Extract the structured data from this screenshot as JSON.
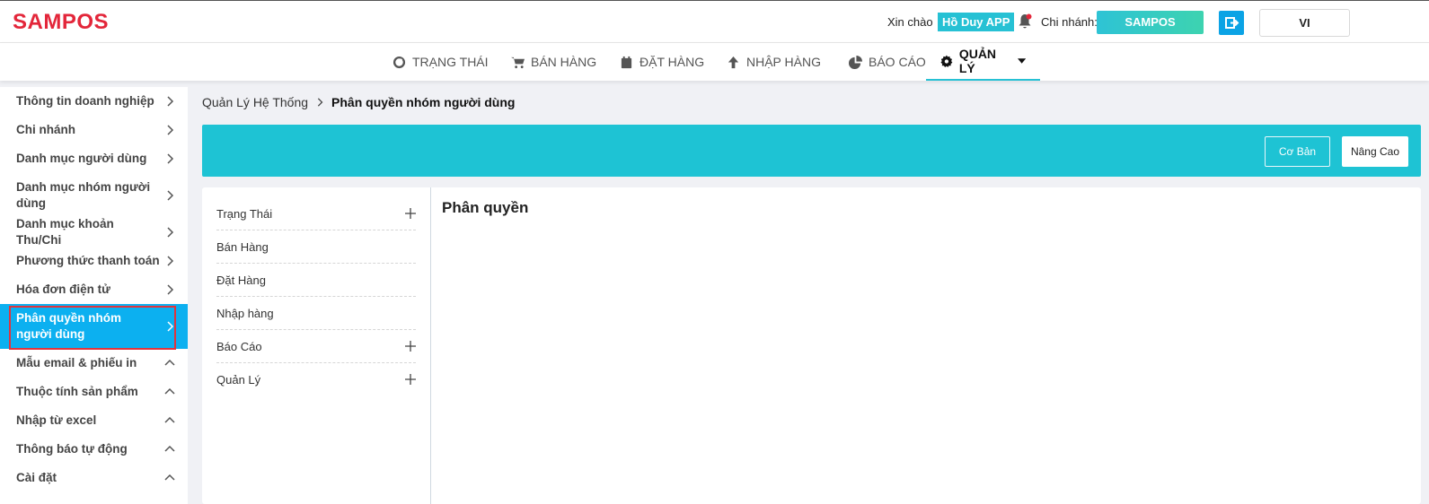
{
  "header": {
    "logo": "SAMPOS",
    "greeting": "Xin chào",
    "user_name": "Hồ Duy APP",
    "branch_label": "Chi nhánh:",
    "branch_name": "SAMPOS",
    "language": "VI",
    "logout_icon": "logout-icon",
    "bell_icon": "bell-icon"
  },
  "nav": {
    "items": [
      {
        "label": "TRẠNG THÁI",
        "icon": "dashboard-icon"
      },
      {
        "label": "BÁN HÀNG",
        "icon": "cart-icon"
      },
      {
        "label": "ĐẶT HÀNG",
        "icon": "calendar-icon"
      },
      {
        "label": "NHẬP HÀNG",
        "icon": "arrow-up-icon"
      },
      {
        "label": "BÁO CÁO",
        "icon": "pie-chart-icon"
      },
      {
        "label": "QUẢN LÝ",
        "icon": "gear-icon",
        "active": true
      }
    ]
  },
  "sidebar": {
    "items": [
      {
        "label": "Thông tin doanh nghiệp",
        "chevron": "right"
      },
      {
        "label": "Chi nhánh",
        "chevron": "right"
      },
      {
        "label": "Danh mục người dùng",
        "chevron": "right"
      },
      {
        "label": "Danh mục nhóm người dùng",
        "chevron": "right"
      },
      {
        "label": "Danh mục khoản Thu/Chi",
        "chevron": "right"
      },
      {
        "label": "Phương thức thanh toán",
        "chevron": "right"
      },
      {
        "label": "Hóa đơn điện tử",
        "chevron": "right"
      },
      {
        "label": "Phân quyền nhóm người dùng",
        "chevron": "right",
        "active": true
      },
      {
        "label": "Mẫu email & phiếu in",
        "chevron": "up"
      },
      {
        "label": "Thuộc tính sản phẩm",
        "chevron": "up"
      },
      {
        "label": "Nhập từ excel",
        "chevron": "up"
      },
      {
        "label": "Thông báo tự động",
        "chevron": "up"
      },
      {
        "label": "Cài đặt",
        "chevron": "up"
      }
    ]
  },
  "breadcrumb": {
    "parent": "Quản Lý Hệ Thống",
    "current": "Phân quyền nhóm người dùng"
  },
  "banner": {
    "basic_label": "Cơ Bản",
    "advanced_label": "Nâng Cao"
  },
  "permissions": {
    "modules": [
      {
        "label": "Trạng Thái",
        "expandable": true
      },
      {
        "label": "Bán Hàng",
        "expandable": false
      },
      {
        "label": "Đặt Hàng",
        "expandable": false
      },
      {
        "label": "Nhập hàng",
        "expandable": false
      },
      {
        "label": "Báo Cáo",
        "expandable": true
      },
      {
        "label": "Quản Lý",
        "expandable": true
      }
    ],
    "title": "Phân quyền"
  },
  "colors": {
    "brand_red": "#e3263a",
    "accent_cyan": "#1ec3d4",
    "sidebar_active": "#0cb0f0",
    "highlight_border": "#e0343d"
  }
}
